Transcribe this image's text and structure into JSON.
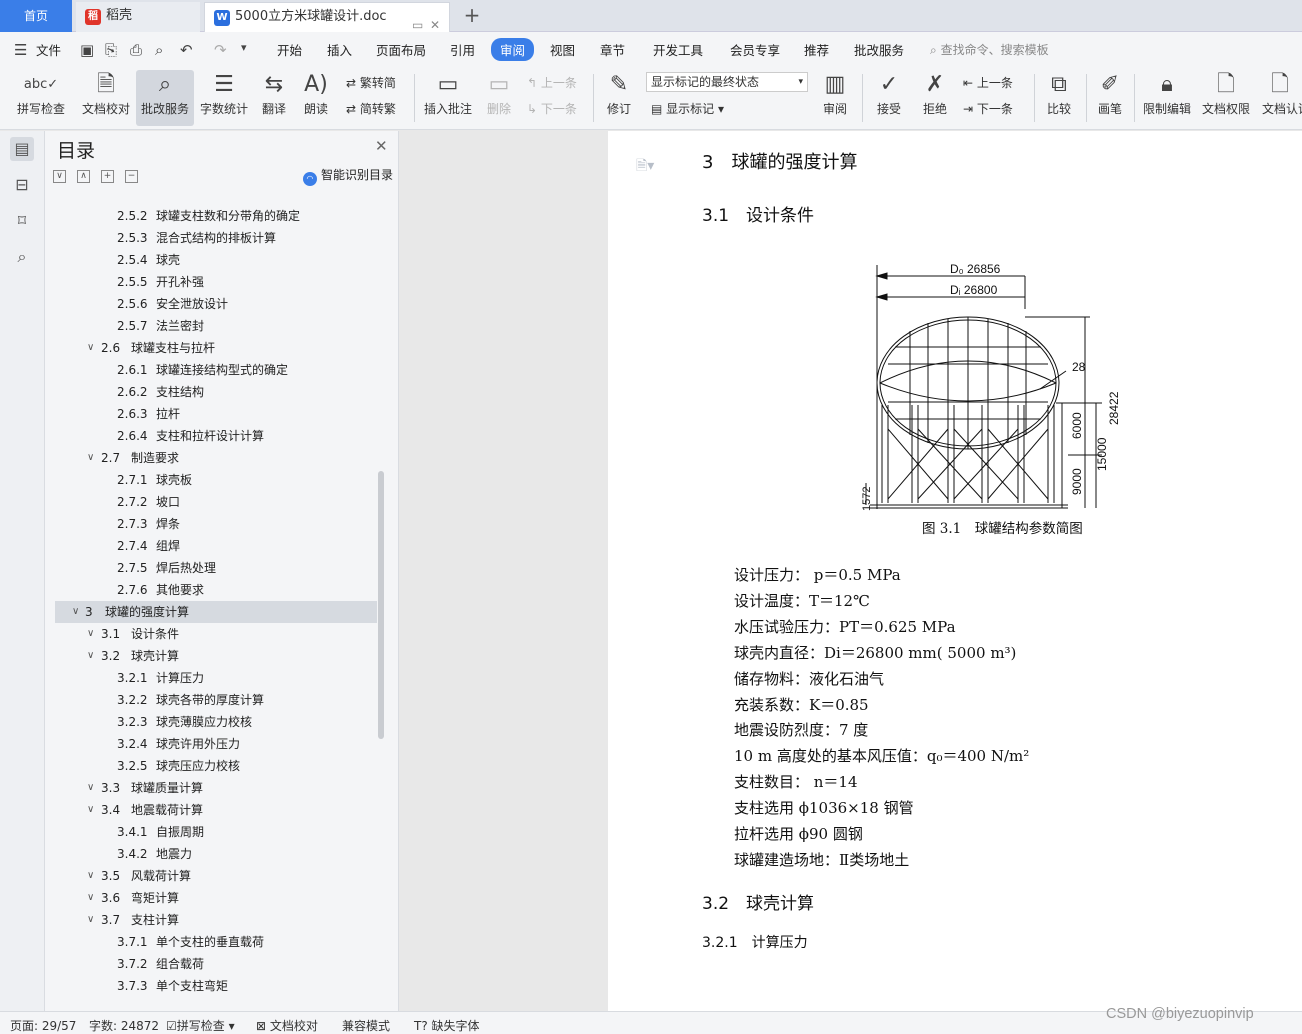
{
  "tabs": {
    "home": "首页",
    "wps": "稻壳",
    "doc": "5000立方米球罐设计.doc",
    "close": "✕",
    "plus": "+"
  },
  "menu": {
    "file": "文件",
    "items": [
      "开始",
      "插入",
      "页面布局",
      "引用",
      "审阅",
      "视图",
      "章节",
      "开发工具",
      "会员专享",
      "推荐",
      "批改服务"
    ],
    "search_placeholder": "查找命令、搜索模板"
  },
  "ribbon": {
    "spellcheck": "拼写检查",
    "proofread": "文档校对",
    "review_service": "批改服务",
    "word_count": "字数统计",
    "translate": "翻译",
    "read_aloud": "朗读",
    "to_simplified": "繁转简",
    "to_traditional": "简转繁",
    "insert_comment": "插入批注",
    "delete": "删除",
    "prev_comment": "上一条",
    "next_comment": "下一条",
    "revise": "修订",
    "markup_state": "显示标记的最终状态",
    "show_markup": "显示标记",
    "reviewing": "审阅",
    "accept": "接受",
    "reject": "拒绝",
    "prev_change": "上一条",
    "next_change": "下一条",
    "compare": "比较",
    "pen": "画笔",
    "restrict_edit": "限制编辑",
    "doc_permission": "文档权限",
    "doc_cert": "文档认证"
  },
  "toc": {
    "title": "目录",
    "smart": "智能识别目录",
    "items": [
      {
        "num": "2.5.2",
        "text": "球罐支柱数和分带角的确定",
        "level": 3
      },
      {
        "num": "2.5.3",
        "text": "混合式结构的排板计算",
        "level": 3
      },
      {
        "num": "2.5.4",
        "text": "球壳",
        "level": 3
      },
      {
        "num": "2.5.5",
        "text": "开孔补强",
        "level": 3
      },
      {
        "num": "2.5.6",
        "text": "安全泄放设计",
        "level": 3
      },
      {
        "num": "2.5.7",
        "text": "法兰密封",
        "level": 3
      },
      {
        "num": "2.6",
        "text": "球罐支柱与拉杆",
        "level": 2
      },
      {
        "num": "2.6.1",
        "text": "球罐连接结构型式的确定",
        "level": 3
      },
      {
        "num": "2.6.2",
        "text": "支柱结构",
        "level": 3
      },
      {
        "num": "2.6.3",
        "text": "拉杆",
        "level": 3
      },
      {
        "num": "2.6.4",
        "text": "支柱和拉杆设计计算",
        "level": 3
      },
      {
        "num": "2.7",
        "text": "制造要求",
        "level": 2
      },
      {
        "num": "2.7.1",
        "text": "球壳板",
        "level": 3
      },
      {
        "num": "2.7.2",
        "text": "坡口",
        "level": 3
      },
      {
        "num": "2.7.3",
        "text": "焊条",
        "level": 3
      },
      {
        "num": "2.7.4",
        "text": "组焊",
        "level": 3
      },
      {
        "num": "2.7.5",
        "text": "焊后热处理",
        "level": 3
      },
      {
        "num": "2.7.6",
        "text": "其他要求",
        "level": 3
      },
      {
        "num": "3",
        "text": "球罐的强度计算",
        "level": 1
      },
      {
        "num": "3.1",
        "text": "设计条件",
        "level": 2
      },
      {
        "num": "3.2",
        "text": "球壳计算",
        "level": 2
      },
      {
        "num": "3.2.1",
        "text": "计算压力",
        "level": 3
      },
      {
        "num": "3.2.2",
        "text": "球壳各带的厚度计算",
        "level": 3
      },
      {
        "num": "3.2.3",
        "text": "球壳薄膜应力校核",
        "level": 3
      },
      {
        "num": "3.2.4",
        "text": "球壳许用外压力",
        "level": 3
      },
      {
        "num": "3.2.5",
        "text": "球壳压应力校核",
        "level": 3
      },
      {
        "num": "3.3",
        "text": "球罐质量计算",
        "level": 2
      },
      {
        "num": "3.4",
        "text": "地震载荷计算",
        "level": 2
      },
      {
        "num": "3.4.1",
        "text": "自振周期",
        "level": 3
      },
      {
        "num": "3.4.2",
        "text": "地震力",
        "level": 3
      },
      {
        "num": "3.5",
        "text": "风载荷计算",
        "level": 2
      },
      {
        "num": "3.6",
        "text": "弯矩计算",
        "level": 2
      },
      {
        "num": "3.7",
        "text": "支柱计算",
        "level": 2
      },
      {
        "num": "3.7.1",
        "text": "单个支柱的垂直载荷",
        "level": 3
      },
      {
        "num": "3.7.2",
        "text": "组合载荷",
        "level": 3
      },
      {
        "num": "3.7.3",
        "text": "单个支柱弯矩",
        "level": 3
      }
    ]
  },
  "doc": {
    "h1": "3　球罐的强度计算",
    "h2a": "3.1　设计条件",
    "figure": {
      "do_label": "D₀ 26856",
      "di_label": "Dᵢ 26800",
      "dim_28": "28",
      "dim_28422": "28422",
      "dim_6000": "6000",
      "dim_15000": "15000",
      "dim_9000": "9000",
      "dim_1572": "1572",
      "caption": "图 3.1　球罐结构参数简图"
    },
    "lines": [
      "设计压力：  p＝0.5 MPa",
      "设计温度：T＝12℃",
      "水压试验压力：PT＝0.625 MPa",
      "球壳内直径：Di＝26800 mm( 5000 m³)",
      "储存物料：液化石油气",
      "充装系数：K＝0.85",
      "地震设防烈度：7 度",
      "10 m 高度处的基本风压值：q₀＝400 N/m²",
      "支柱数目：  n＝14",
      "支柱选用  ϕ1036×18 钢管",
      "拉杆选用 ϕ90 圆钢",
      "球罐建造场地：Ⅱ类场地土"
    ],
    "h2b": "3.2　球壳计算",
    "h3": "3.2.1　计算压力"
  },
  "status": {
    "page": "页面: 29/57",
    "words": "字数: 24872",
    "spell": "拼写检查",
    "proof": "文档校对",
    "compat": "兼容模式",
    "missing_font": "缺失字体"
  },
  "watermark": "CSDN @biyezuopinvip"
}
